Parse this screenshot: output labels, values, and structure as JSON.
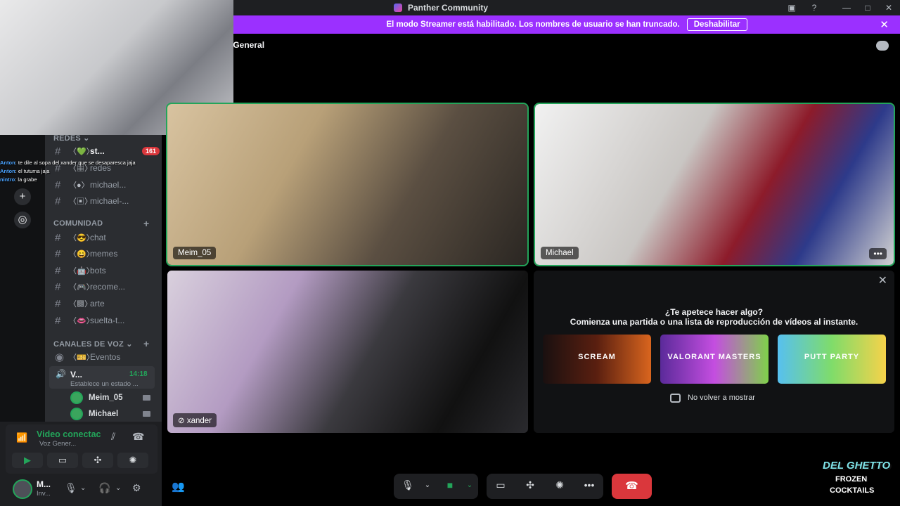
{
  "window": {
    "title": "Panther Community"
  },
  "streamer_bar": {
    "message": "El modo Streamer está habilitado. Los nombres de usuario se han truncado.",
    "disable_label": "Deshabilitar"
  },
  "channel_header": {
    "name": "z General"
  },
  "chat_overlay": [
    {
      "user": "Anton",
      "text": ": te dile al sopa del xander que se desaparesca jaja"
    },
    {
      "user": "Anton",
      "text": ": el tutuma jaja"
    },
    {
      "user": "nintro",
      "text": ": la grabe"
    }
  ],
  "categories": {
    "redes": {
      "label": "REDES"
    },
    "comunidad": {
      "label": "COMUNIDAD"
    },
    "voz": {
      "label": "CANALES DE VOZ"
    }
  },
  "channels_redes": [
    {
      "name": "st...",
      "badge": "161"
    },
    {
      "name": "redes"
    },
    {
      "name": "michael..."
    },
    {
      "name": "michael-..."
    }
  ],
  "channels_comunidad": [
    {
      "name": "chat"
    },
    {
      "name": "memes"
    },
    {
      "name": "bots"
    },
    {
      "name": "recome..."
    },
    {
      "name": "arte"
    },
    {
      "name": "suelta-t..."
    }
  ],
  "voice_channels": {
    "eventos": "Eventos",
    "active_name": "V...",
    "active_time": "14:18",
    "active_status": "Establece un estado ...",
    "users": [
      "Meim_05",
      "Michael"
    ]
  },
  "voice_panel": {
    "status": "Video conectac",
    "channel": "Voz Gener..."
  },
  "user_panel": {
    "name": "M...",
    "status": "Inv..."
  },
  "tiles": [
    {
      "label": "Meim_05"
    },
    {
      "label": "Michael",
      "more": "•••"
    },
    {
      "label": "xander"
    }
  ],
  "activity": {
    "question": "¿Te apetece hacer algo?",
    "subtitle": "Comienza una partida o una lista de reproducción de vídeos al instante.",
    "games": [
      "SCREAM",
      "VALORANT MASTERS",
      "PUTT PARTY"
    ],
    "checkbox_label": "No volver a mostrar"
  },
  "logo": {
    "line1": "DEL GHETTO",
    "line2": "FROZEN",
    "line3": "COCKTAILS"
  },
  "colors": {
    "accent_green": "#23a55a",
    "streamer_purple": "#9b30ff",
    "hangup_red": "#da373c"
  }
}
